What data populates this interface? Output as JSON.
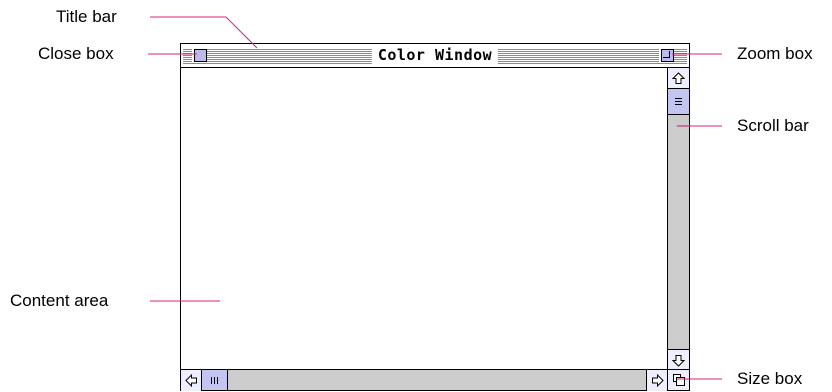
{
  "window": {
    "title": "Color Window"
  },
  "callouts": {
    "title_bar": "Title bar",
    "close_box": "Close box",
    "content_area": "Content area",
    "zoom_box": "Zoom box",
    "scroll_bar": "Scroll bar",
    "size_box": "Size box"
  },
  "colors": {
    "leader_line": "#d4237a",
    "control_fill": "#bcbcea",
    "thumb_fill": "#c4c4f0"
  },
  "icons": [
    "close-box-icon",
    "zoom-box-icon",
    "up-arrow-icon",
    "down-arrow-icon",
    "left-arrow-icon",
    "right-arrow-icon",
    "size-box-icon"
  ]
}
